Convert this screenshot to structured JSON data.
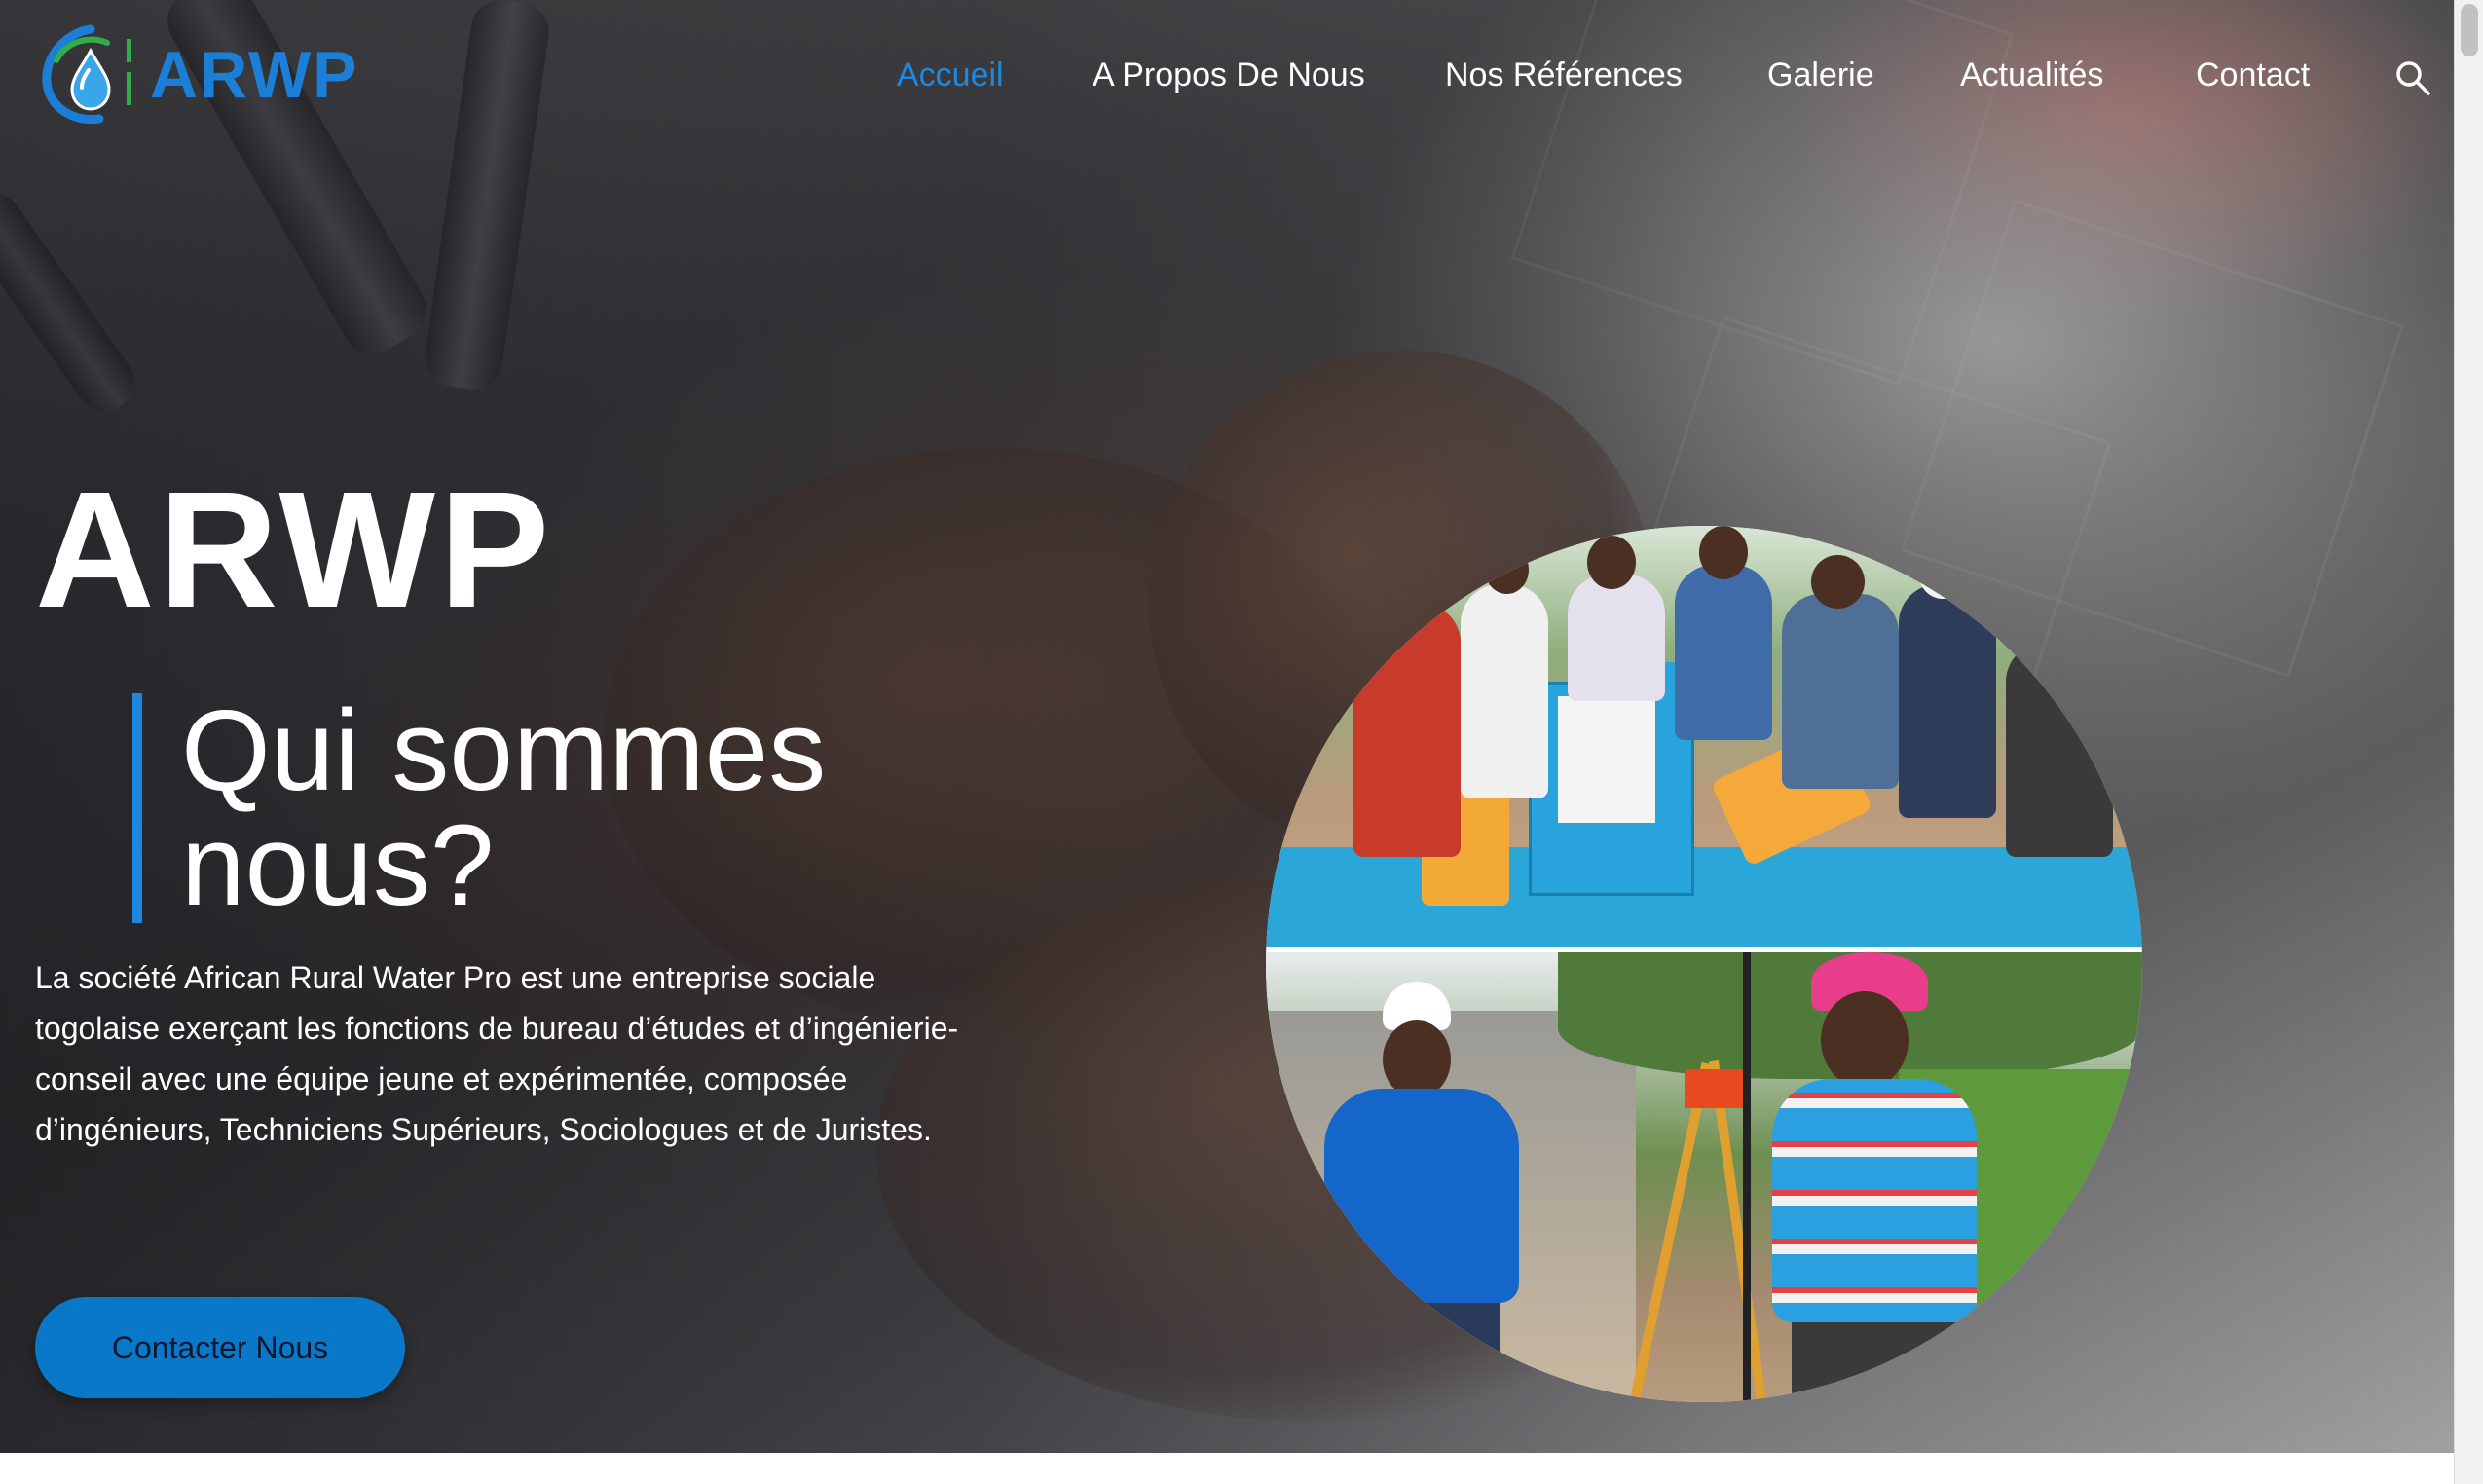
{
  "brand": {
    "logo_text": "ARWP",
    "accent_color": "#1d88e0",
    "cta_color": "#0a78c8"
  },
  "nav": {
    "items": [
      {
        "label": "Accueil",
        "active": true
      },
      {
        "label": "A Propos De Nous",
        "active": false
      },
      {
        "label": "Nos Références",
        "active": false
      },
      {
        "label": "Galerie",
        "active": false
      },
      {
        "label": "Actualités",
        "active": false
      },
      {
        "label": "Contact",
        "active": false
      }
    ],
    "search_icon": "search-icon"
  },
  "hero": {
    "title": "ARWP",
    "subtitle": "Qui sommes nous?",
    "description": "La société African Rural Water Pro est une entreprise sociale togolaise exerçant les fonctions de bureau d’études et d’ingénierie-conseil avec une équipe jeune et expérimentée, composée d’ingénieurs, Techniciens Supérieurs, Sociologues et de Juristes.",
    "cta_label": "Contacter Nous"
  }
}
